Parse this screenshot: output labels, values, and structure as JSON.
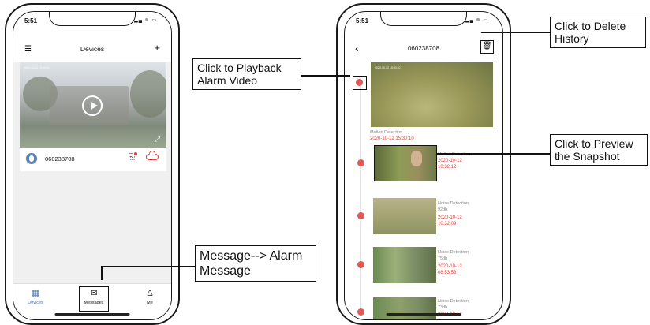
{
  "phone1": {
    "time": "5:51",
    "header": {
      "title": "Devices"
    },
    "video": {
      "stamp": "2020-10-12  13:53:10"
    },
    "device": {
      "name": "060238708"
    },
    "tabs": [
      {
        "label": "Devices",
        "icon": "grid-icon"
      },
      {
        "label": "Messages",
        "icon": "envelope-icon"
      },
      {
        "label": "Me",
        "icon": "person-icon"
      }
    ]
  },
  "phone2": {
    "time": "5:51",
    "header": {
      "title": "060238708"
    },
    "big_event": {
      "stamp": "2020-10-12  15:30:10",
      "label": "Motion Detection",
      "datetime": "2020-10-12  15:30:10"
    },
    "events": [
      {
        "label": "Motion Detection",
        "date": "2020-10-12",
        "time": "10:32:12"
      },
      {
        "label": "Noise Detection",
        "level": "92db",
        "date": "2020-10-12",
        "time": "10:32:09"
      },
      {
        "label": "Noise Detection",
        "level": "75db",
        "date": "2020-10-12",
        "time": "08:53:53"
      },
      {
        "label": "Noise Detection",
        "level": "73db",
        "date": "2020-10-12",
        "time": ""
      }
    ]
  },
  "callouts": {
    "playback": "Click to Playback Alarm Video",
    "delete": "Click to Delete History",
    "preview": "Click to Preview the Snapshot",
    "message": "Message--> Alarm Message"
  },
  "colors": {
    "accent_red": "#e53935",
    "active_tab": "#4a76a8"
  }
}
